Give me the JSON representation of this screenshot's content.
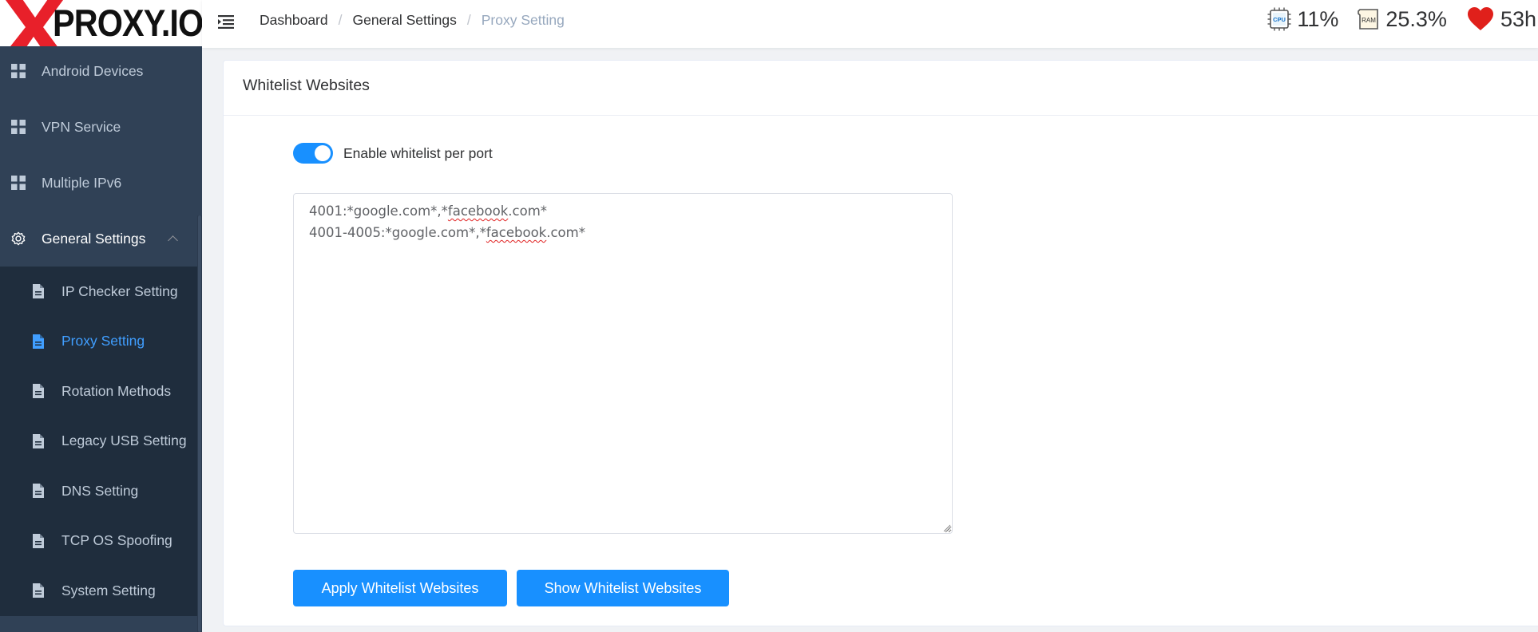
{
  "logo": {
    "text": "PROXY.IO"
  },
  "header": {
    "breadcrumb": [
      "Dashboard",
      "General Settings",
      "Proxy Setting"
    ],
    "stats": {
      "cpu": "11%",
      "ram": "25.3%",
      "uptime": "53h"
    },
    "cpu_icon_text": "CPU",
    "ram_icon_text": "RAM"
  },
  "sidebar": {
    "items": [
      {
        "label": "Android Devices",
        "icon": "grid-icon"
      },
      {
        "label": "VPN Service",
        "icon": "grid-icon"
      },
      {
        "label": "Multiple IPv6",
        "icon": "grid-icon"
      },
      {
        "label": "General Settings",
        "icon": "gear-icon",
        "expanded": true
      }
    ],
    "subitems": [
      {
        "label": "IP Checker Setting",
        "icon": "document-icon"
      },
      {
        "label": "Proxy Setting",
        "icon": "document-icon",
        "active": true
      },
      {
        "label": "Rotation Methods",
        "icon": "document-icon"
      },
      {
        "label": "Legacy USB Setting",
        "icon": "document-icon"
      },
      {
        "label": "DNS Setting",
        "icon": "document-icon"
      },
      {
        "label": "TCP OS Spoofing",
        "icon": "document-icon"
      },
      {
        "label": "System Setting",
        "icon": "document-icon"
      }
    ]
  },
  "card": {
    "title": "Whitelist Websites",
    "switch_label": "Enable whitelist per port",
    "switch_on": true,
    "textarea_lines": [
      [
        "4001:*google.com*,*",
        "facebook",
        ".com*"
      ],
      [
        "4001-4005:*google.com*,*",
        "facebook",
        ".com*"
      ]
    ],
    "apply_button": "Apply Whitelist Websites",
    "show_button": "Show Whitelist Websites"
  },
  "colors": {
    "sidebar_bg": "#304156",
    "submenu_bg": "#1f2d3d",
    "active": "#409eff",
    "primary_button": "#1890ff",
    "heart": "#e0201b"
  }
}
